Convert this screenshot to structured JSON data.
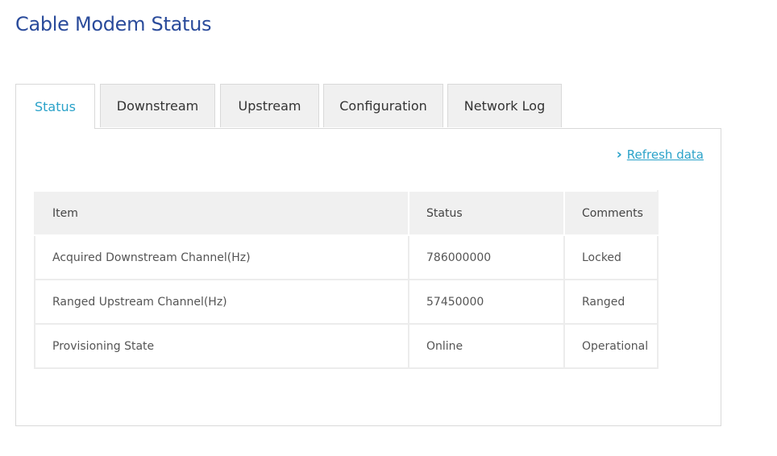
{
  "page": {
    "title": "Cable Modem Status"
  },
  "tabs": [
    {
      "label": "Status",
      "active": true
    },
    {
      "label": "Downstream",
      "active": false
    },
    {
      "label": "Upstream",
      "active": false
    },
    {
      "label": "Configuration",
      "active": false
    },
    {
      "label": "Network Log",
      "active": false
    }
  ],
  "refresh": {
    "label": "Refresh data",
    "icon": "chevron-right-icon"
  },
  "table": {
    "headers": [
      "Item",
      "Status",
      "Comments"
    ],
    "rows": [
      [
        "Acquired Downstream Channel(Hz)",
        "786000000",
        "Locked"
      ],
      [
        "Ranged Upstream Channel(Hz)",
        "57450000",
        "Ranged"
      ],
      [
        "Provisioning State",
        "Online",
        "Operational"
      ]
    ]
  },
  "colors": {
    "title": "#2a4b9b",
    "accent": "#2aa2c9",
    "tab_inactive_bg": "#f0f0f0",
    "header_bg": "#f0f0f0"
  }
}
